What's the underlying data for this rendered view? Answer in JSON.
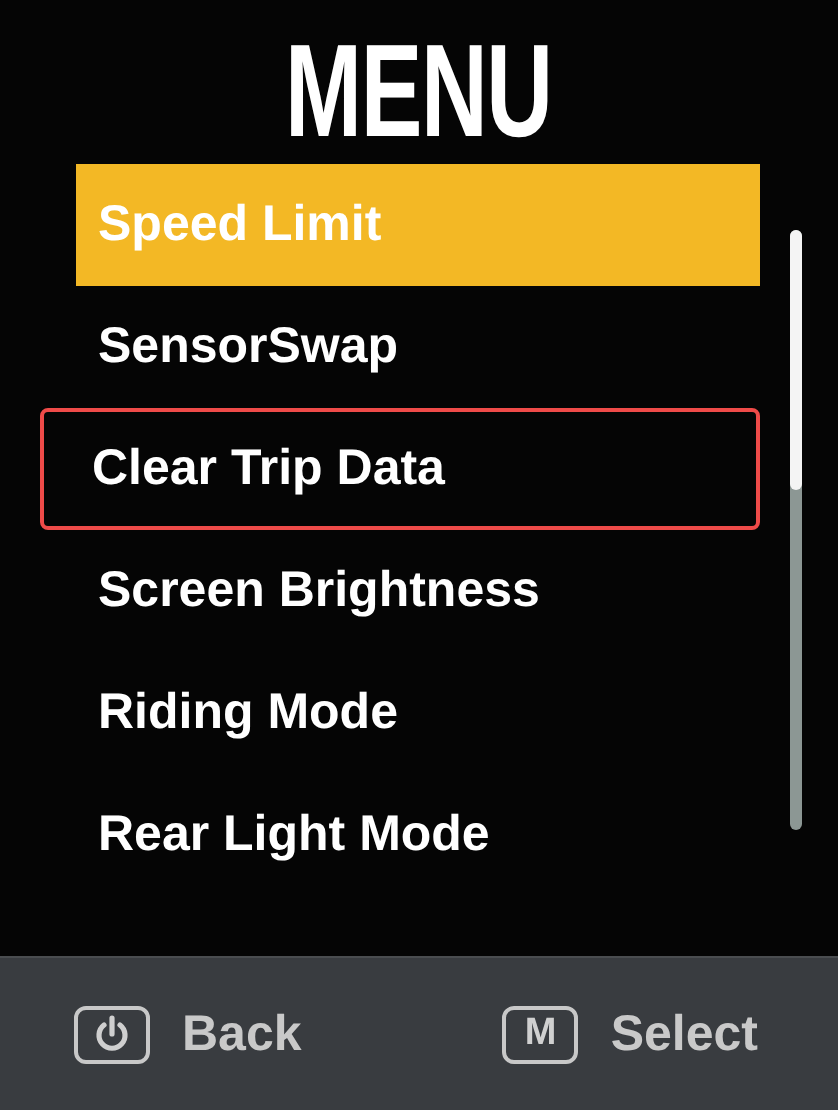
{
  "title": "MENU",
  "items": [
    {
      "label": "Speed Limit",
      "selected": true,
      "outlined": false
    },
    {
      "label": "SensorSwap",
      "selected": false,
      "outlined": false
    },
    {
      "label": "Clear Trip Data",
      "selected": false,
      "outlined": true
    },
    {
      "label": "Screen Brightness",
      "selected": false,
      "outlined": false
    },
    {
      "label": "Riding Mode",
      "selected": false,
      "outlined": false
    },
    {
      "label": "Rear Light Mode",
      "selected": false,
      "outlined": false
    }
  ],
  "footer": [
    {
      "kind": "power",
      "label": "Back"
    },
    {
      "kind": "key",
      "key": "M",
      "label": "Select"
    }
  ]
}
